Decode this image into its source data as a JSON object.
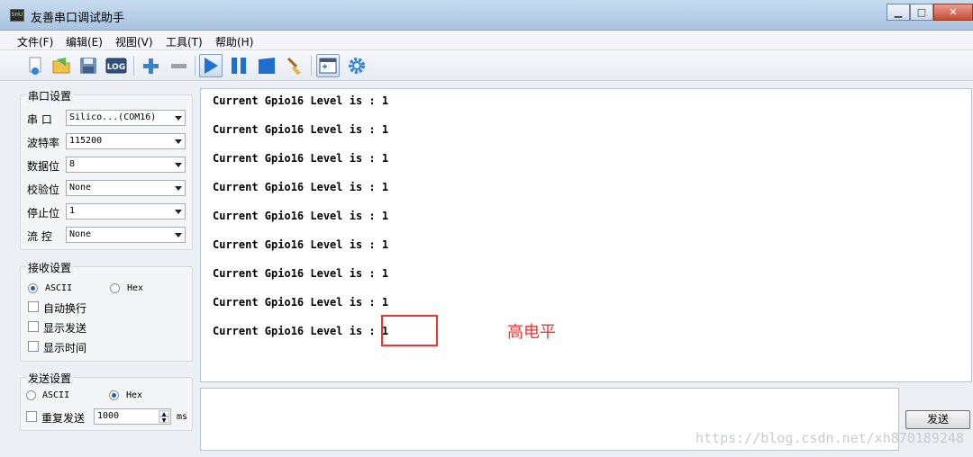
{
  "window": {
    "title": "友善串口调试助手",
    "icon_label": "SHU",
    "minimize_glyph": "▁",
    "maximize_glyph": "□",
    "close_glyph": "✕"
  },
  "menu": [
    "文件(F)",
    "编辑(E)",
    "视图(V)",
    "工具(T)",
    "帮助(H)"
  ],
  "toolbar": {
    "log_label": "LOG",
    "buttons": [
      "new-file-icon",
      "open-file-icon",
      "save-icon",
      "log-icon",
      "add-icon",
      "remove-icon",
      "play-icon",
      "pause-icon",
      "stop-icon",
      "clear-icon",
      "window-icon",
      "settings-icon"
    ],
    "active": [
      "play-icon",
      "window-icon"
    ]
  },
  "serial_settings": {
    "title": "串口设置",
    "port_label": "串  口",
    "port_value": "Silico...(COM16)",
    "baud_label": "波特率",
    "baud_value": "115200",
    "data_bits_label": "数据位",
    "data_bits_value": "8",
    "parity_label": "校验位",
    "parity_value": "None",
    "stop_bits_label": "停止位",
    "stop_bits_value": "1",
    "flow_label": "流  控",
    "flow_value": "None"
  },
  "receive_settings": {
    "title": "接收设置",
    "ascii_label": "ASCII",
    "hex_label": "Hex",
    "selected": "ASCII",
    "auto_wrap_label": "自动换行",
    "show_send_label": "显示发送",
    "show_time_label": "显示时间"
  },
  "send_settings": {
    "title": "发送设置",
    "ascii_label": "ASCII",
    "hex_label": "Hex",
    "selected": "Hex",
    "repeat_label": "重复发送",
    "interval_value": "1000",
    "interval_unit": "ms"
  },
  "receive_lines": [
    "Current Gpio16 Level is : 1",
    "Current Gpio16 Level is : 1",
    "Current Gpio16 Level is : 1",
    "Current Gpio16 Level is : 1",
    "Current Gpio16 Level is : 1",
    "Current Gpio16 Level is : 1",
    "Current Gpio16 Level is : 1",
    "Current Gpio16 Level is : 1",
    "Current Gpio16 Level is : 1"
  ],
  "annotation": "高电平",
  "send_button_label": "发送",
  "watermark": "https://blog.csdn.net/xh870189248",
  "colors": {
    "annotation": "#ee3333",
    "accent": "#2a6fc9"
  }
}
